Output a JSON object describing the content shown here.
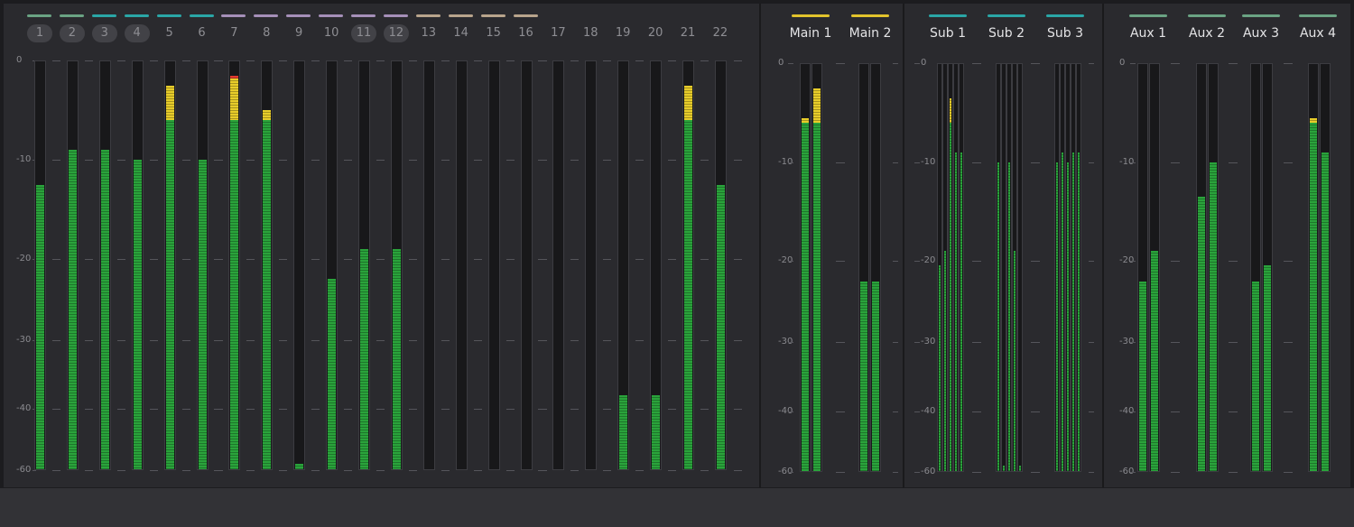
{
  "scale": {
    "ticks": [
      "0",
      "-10",
      "-20",
      "-30",
      "-40",
      "-60"
    ]
  },
  "colors": {
    "green": "#6aa383",
    "teal": "#2aa6a6",
    "violet": "#a58fb8",
    "tan": "#b8a48c",
    "yellow": "#e2c42c",
    "meter_green": "#2aa33b",
    "meter_yellow": "#e7cc2a",
    "meter_red": "#e23b2f"
  },
  "tracks": [
    {
      "label": "1",
      "color": "green",
      "linked": true,
      "levels": [
        -12.5
      ]
    },
    {
      "label": "2",
      "color": "green",
      "linked": true,
      "levels": [
        -9
      ]
    },
    {
      "label": "3",
      "color": "teal",
      "linked": true,
      "levels": [
        -9
      ]
    },
    {
      "label": "4",
      "color": "teal",
      "linked": true,
      "levels": [
        -10
      ]
    },
    {
      "label": "5",
      "color": "teal",
      "linked": false,
      "levels": [
        -2.5
      ]
    },
    {
      "label": "6",
      "color": "teal",
      "linked": false,
      "levels": [
        -10
      ]
    },
    {
      "label": "7",
      "color": "violet",
      "linked": false,
      "levels": [
        -1.5
      ]
    },
    {
      "label": "8",
      "color": "violet",
      "linked": false,
      "levels": [
        -5
      ]
    },
    {
      "label": "9",
      "color": "violet",
      "linked": false,
      "levels": [
        -58
      ]
    },
    {
      "label": "10",
      "color": "violet",
      "linked": false,
      "levels": [
        -22.5
      ]
    },
    {
      "label": "11",
      "color": "violet",
      "linked": true,
      "levels": [
        -19
      ]
    },
    {
      "label": "12",
      "color": "violet",
      "linked": true,
      "levels": [
        -19
      ]
    },
    {
      "label": "13",
      "color": "tan",
      "linked": false,
      "levels": [
        -60
      ]
    },
    {
      "label": "14",
      "color": "tan",
      "linked": false,
      "levels": [
        -60
      ]
    },
    {
      "label": "15",
      "color": "tan",
      "linked": false,
      "levels": [
        -60
      ]
    },
    {
      "label": "16",
      "color": "tan",
      "linked": false,
      "levels": [
        -60
      ]
    },
    {
      "label": "17",
      "color": "none",
      "linked": false,
      "levels": [
        -60
      ]
    },
    {
      "label": "18",
      "color": "none",
      "linked": false,
      "levels": [
        -60
      ]
    },
    {
      "label": "19",
      "color": "none",
      "linked": false,
      "levels": [
        -38
      ]
    },
    {
      "label": "20",
      "color": "none",
      "linked": false,
      "levels": [
        -38
      ]
    },
    {
      "label": "21",
      "color": "none",
      "linked": false,
      "levels": [
        -2.5
      ]
    },
    {
      "label": "22",
      "color": "none",
      "linked": false,
      "levels": [
        -12.5
      ]
    }
  ],
  "buses": {
    "main": [
      {
        "label": "Main 1",
        "color": "yellow",
        "levels": [
          -5.5,
          -2.5
        ]
      },
      {
        "label": "Main 2",
        "color": "yellow",
        "levels": [
          -22.5,
          -22.5
        ]
      }
    ],
    "sub": [
      {
        "label": "Sub 1",
        "color": "teal",
        "levels": [
          -20.5,
          -19,
          -3.5,
          -9,
          -9
        ]
      },
      {
        "label": "Sub 2",
        "color": "teal",
        "levels": [
          -10,
          -58,
          -10,
          -19,
          -58
        ]
      },
      {
        "label": "Sub 3",
        "color": "teal",
        "levels": [
          -10,
          -9,
          -10,
          -9,
          -9
        ]
      }
    ],
    "aux": [
      {
        "label": "Aux 1",
        "color": "green",
        "levels": [
          -22.5,
          -19
        ]
      },
      {
        "label": "Aux 2",
        "color": "green",
        "levels": [
          -13.5,
          -10
        ]
      },
      {
        "label": "Aux 3",
        "color": "green",
        "levels": [
          -22.5,
          -20.5
        ]
      },
      {
        "label": "Aux 4",
        "color": "green",
        "levels": [
          -5.5,
          -9
        ]
      }
    ]
  }
}
